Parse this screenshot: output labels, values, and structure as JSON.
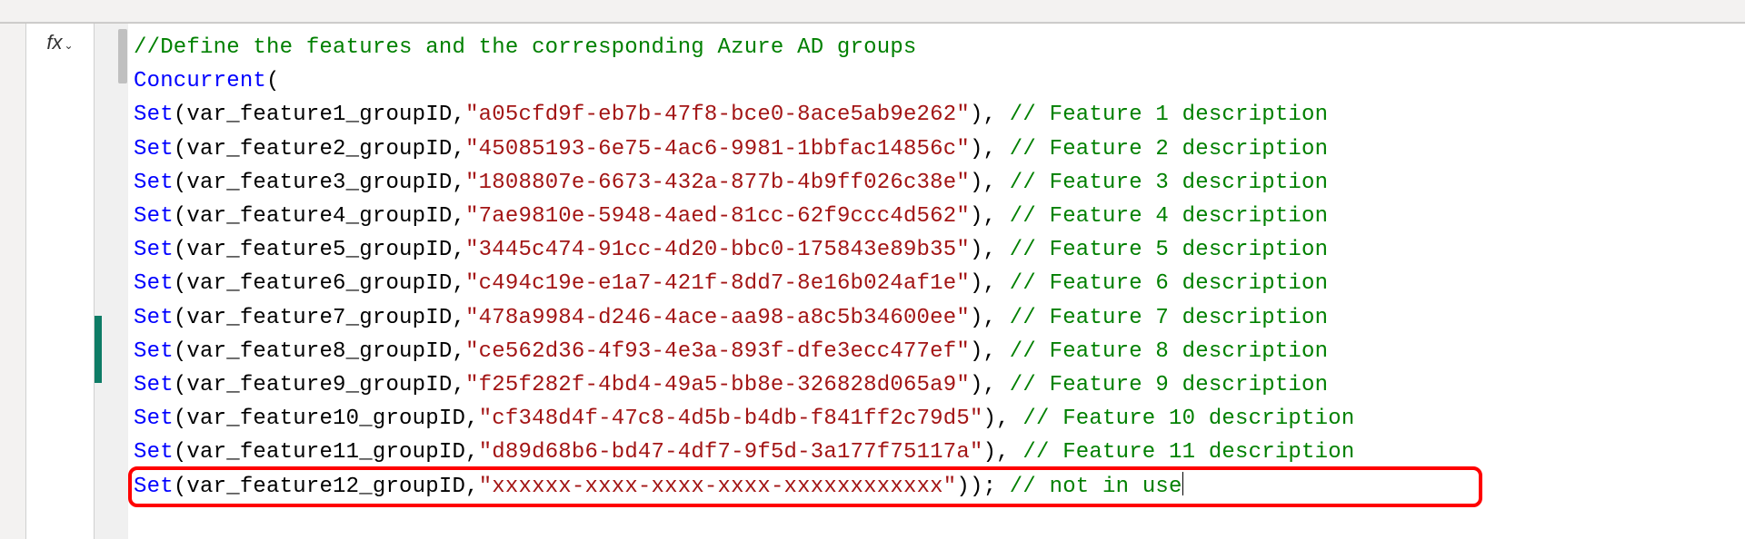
{
  "fx_label": "fx",
  "code": {
    "header_comment": "//Define the features and the corresponding Azure AD groups",
    "concurrent": "Concurrent",
    "set": "Set",
    "open_paren": "(",
    "close_paren": ")",
    "comma": ",",
    "semicolon": ";",
    "close2": "))",
    "slash_comment": "//",
    "lines": [
      {
        "var": "var_feature1_groupID",
        "guid": "\"a05cfd9f-eb7b-47f8-bce0-8ace5ab9e262\"",
        "comment": " Feature 1 description"
      },
      {
        "var": "var_feature2_groupID",
        "guid": "\"45085193-6e75-4ac6-9981-1bbfac14856c\"",
        "comment": " Feature 2 description"
      },
      {
        "var": "var_feature3_groupID",
        "guid": "\"1808807e-6673-432a-877b-4b9ff026c38e\"",
        "comment": " Feature 3 description"
      },
      {
        "var": "var_feature4_groupID",
        "guid": "\"7ae9810e-5948-4aed-81cc-62f9ccc4d562\"",
        "comment": " Feature 4 description"
      },
      {
        "var": "var_feature5_groupID",
        "guid": "\"3445c474-91cc-4d20-bbc0-175843e89b35\"",
        "comment": " Feature 5 description"
      },
      {
        "var": "var_feature6_groupID",
        "guid": "\"c494c19e-e1a7-421f-8dd7-8e16b024af1e\"",
        "comment": " Feature 6 description"
      },
      {
        "var": "var_feature7_groupID",
        "guid": "\"478a9984-d246-4ace-aa98-a8c5b34600ee\"",
        "comment": " Feature 7 description"
      },
      {
        "var": "var_feature8_groupID",
        "guid": "\"ce562d36-4f93-4e3a-893f-dfe3ecc477ef\"",
        "comment": " Feature 8 description"
      },
      {
        "var": "var_feature9_groupID",
        "guid": "\"f25f282f-4bd4-49a5-bb8e-326828d065a9\"",
        "comment": " Feature 9 description"
      },
      {
        "var": "var_feature10_groupID",
        "guid": "\"cf348d4f-47c8-4d5b-b4db-f841ff2c79d5\"",
        "comment": " Feature 10 description"
      },
      {
        "var": "var_feature11_groupID",
        "guid": "\"d89d68b6-bd47-4df7-9f5d-3a177f75117a\"",
        "comment": " Feature 11 description"
      },
      {
        "var": "var_feature12_groupID",
        "guid": "\"xxxxxx-xxxx-xxxx-xxxx-xxxxxxxxxxxx\"",
        "comment": " not in use"
      }
    ]
  }
}
